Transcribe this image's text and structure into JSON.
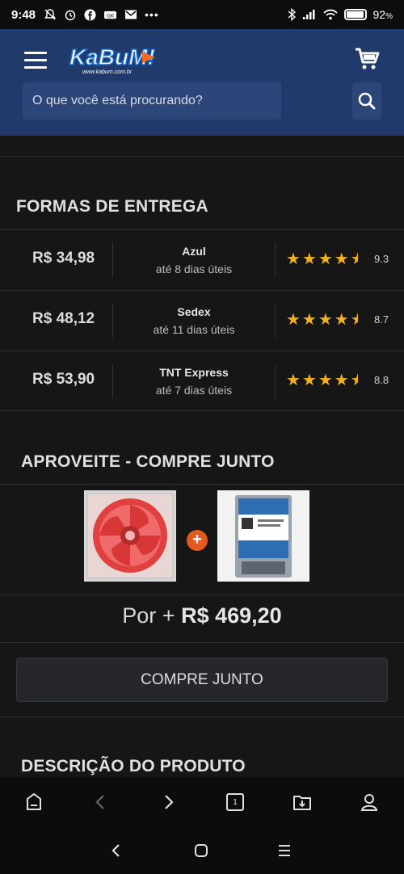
{
  "status_bar": {
    "time": "9:48",
    "battery": "92",
    "battery_unit": "%",
    "icons": [
      "silent-icon",
      "alarm-icon",
      "facebook-icon",
      "game-icon",
      "gmail-icon",
      "more-icon",
      "bluetooth-icon",
      "signal-icon",
      "wifi-icon",
      "battery-icon"
    ]
  },
  "header": {
    "logo_text": "KaBuM!",
    "logo_url_text": "www.kabum.com.br",
    "search_placeholder": "O que você está procurando?",
    "colors": {
      "background": "#203a6c",
      "search": "#2c4679",
      "logo_orange": "#f26b21"
    }
  },
  "shipping": {
    "title": "FORMAS DE ENTREGA",
    "options": [
      {
        "price": "R$ 34,98",
        "carrier": "Azul",
        "eta": "até 8 dias úteis",
        "rating": "9.3",
        "stars": 4.5
      },
      {
        "price": "R$ 48,12",
        "carrier": "Sedex",
        "eta": "até 11 dias úteis",
        "rating": "8.7",
        "stars": 4.5
      },
      {
        "price": "R$ 53,90",
        "carrier": "TNT Express",
        "eta": "até 7 dias úteis",
        "rating": "8.8",
        "stars": 4.5
      }
    ],
    "star_color": "#f2b01e"
  },
  "combo": {
    "title": "APROVEITE - COMPRE JUNTO",
    "products": [
      "red-led-fan",
      "wd-blue-hard-drive"
    ],
    "plus_symbol": "+",
    "price_prefix": "Por +",
    "price_amount": "R$ 469,20",
    "button_label": "COMPRE JUNTO",
    "accent": "#e35a1e"
  },
  "description": {
    "title": "DESCRIÇÃO DO PRODUTO"
  },
  "browser_bar": {
    "tab_count": "1",
    "icons": [
      "home-icon",
      "back-icon",
      "forward-icon",
      "tabs-icon",
      "downloads-icon",
      "profile-icon"
    ]
  },
  "system_nav": {
    "icons": [
      "nav-back-icon",
      "nav-home-icon",
      "nav-recents-icon"
    ]
  }
}
